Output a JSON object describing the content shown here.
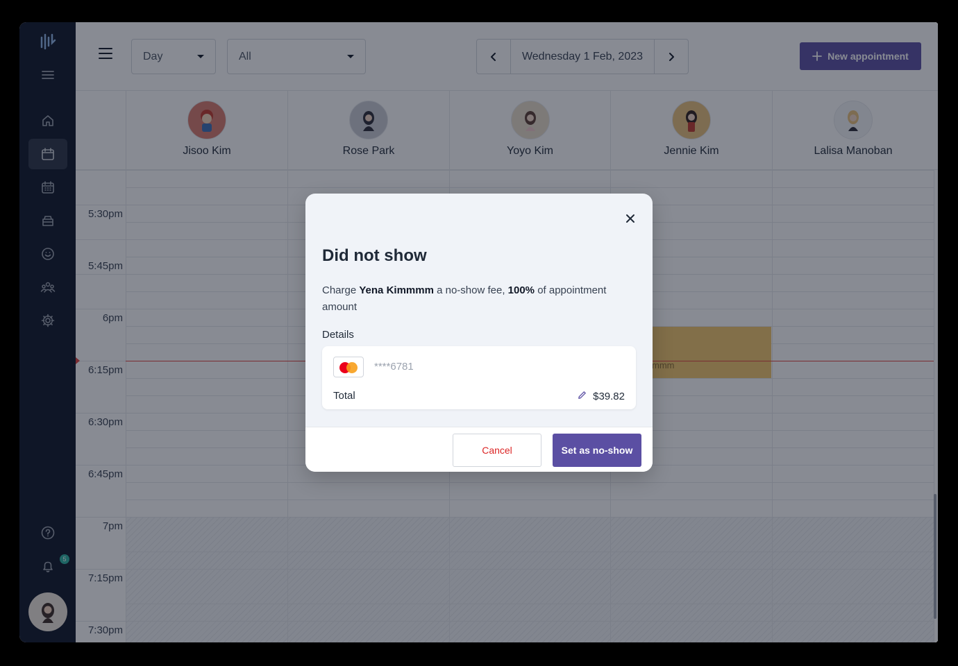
{
  "toolbar": {
    "view_select": "Day",
    "filter_select": "All",
    "date": "Wednesday 1 Feb, 2023",
    "new_appointment": "New appointment"
  },
  "staff": [
    {
      "name": "Jisoo Kim",
      "avatar_color": "#d97b6c"
    },
    {
      "name": "Rose Park",
      "avatar_color": "#c9cbd3"
    },
    {
      "name": "Yoyo Kim",
      "avatar_color": "#e8dcc8"
    },
    {
      "name": "Jennie Kim",
      "avatar_color": "#e8c07a"
    },
    {
      "name": "Lalisa Manoban",
      "avatar_color": "#f3f4f6"
    }
  ],
  "time_labels": [
    "5:30pm",
    "5:45pm",
    "6pm",
    "6:15pm",
    "6:30pm",
    "6:45pm",
    "7pm",
    "7:15pm",
    "7:30pm"
  ],
  "sidebar": {
    "notification_count": "5"
  },
  "appointment": {
    "text": "mmm",
    "color": "#f2c66b"
  },
  "modal": {
    "title": "Did not show",
    "charge_prefix": "Charge ",
    "client_name": "Yena Kimmmm",
    "charge_middle": " a no-show fee, ",
    "percent": "100%",
    "charge_suffix": " of appointment amount",
    "details_label": "Details",
    "card_number": "****6781",
    "total_label": "Total",
    "total_value": "$39.82",
    "cancel": "Cancel",
    "confirm": "Set as no-show"
  },
  "colors": {
    "accent": "#5b4fa3",
    "sidebar": "#0d1526",
    "now_line": "#e0413d",
    "cancel_text": "#dc2626"
  }
}
